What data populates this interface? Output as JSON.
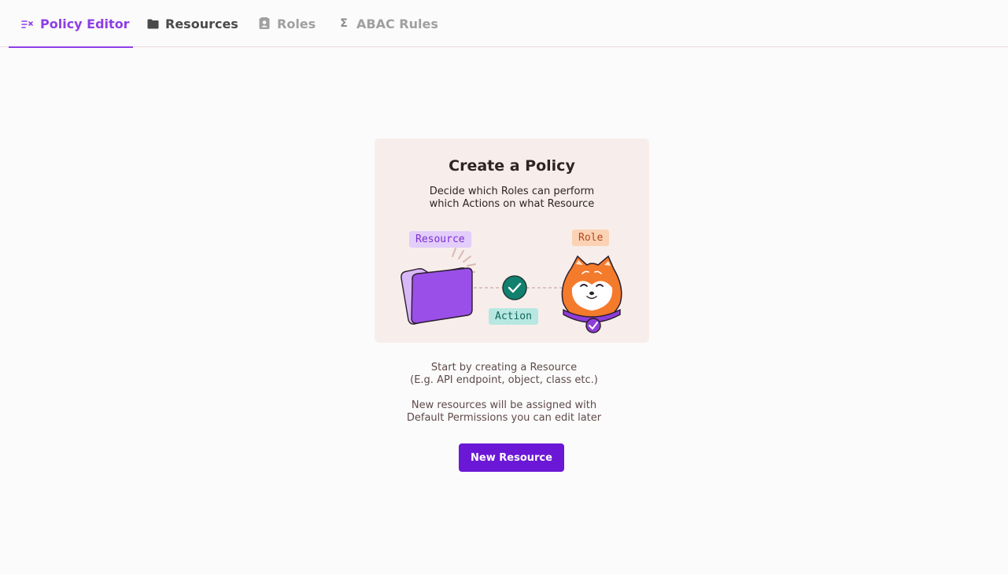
{
  "tabs": [
    {
      "label": "Policy Editor",
      "icon": "policy-icon",
      "state": "active"
    },
    {
      "label": "Resources",
      "icon": "folder-icon",
      "state": "normal"
    },
    {
      "label": "Roles",
      "icon": "contact-card-icon",
      "state": "muted"
    },
    {
      "label": "ABAC Rules",
      "icon": "sigma-icon",
      "state": "muted"
    }
  ],
  "card": {
    "title": "Create a Policy",
    "subtitle_line1": "Decide which Roles can perform",
    "subtitle_line2": "which Actions on what Resource",
    "chip_resource": "Resource",
    "chip_role": "Role",
    "chip_action": "Action"
  },
  "info": {
    "line1": "Start by creating a Resource",
    "line2": "(E.g. API endpoint, object, class etc.)",
    "line3": "New resources will be assigned with",
    "line4": "Default Permissions you can edit later"
  },
  "button": {
    "label": "New Resource"
  },
  "colors": {
    "accent": "#8e3ee6",
    "button": "#6b17d6",
    "card_bg": "#f7eeeb",
    "action_green": "#0f7a6a"
  }
}
